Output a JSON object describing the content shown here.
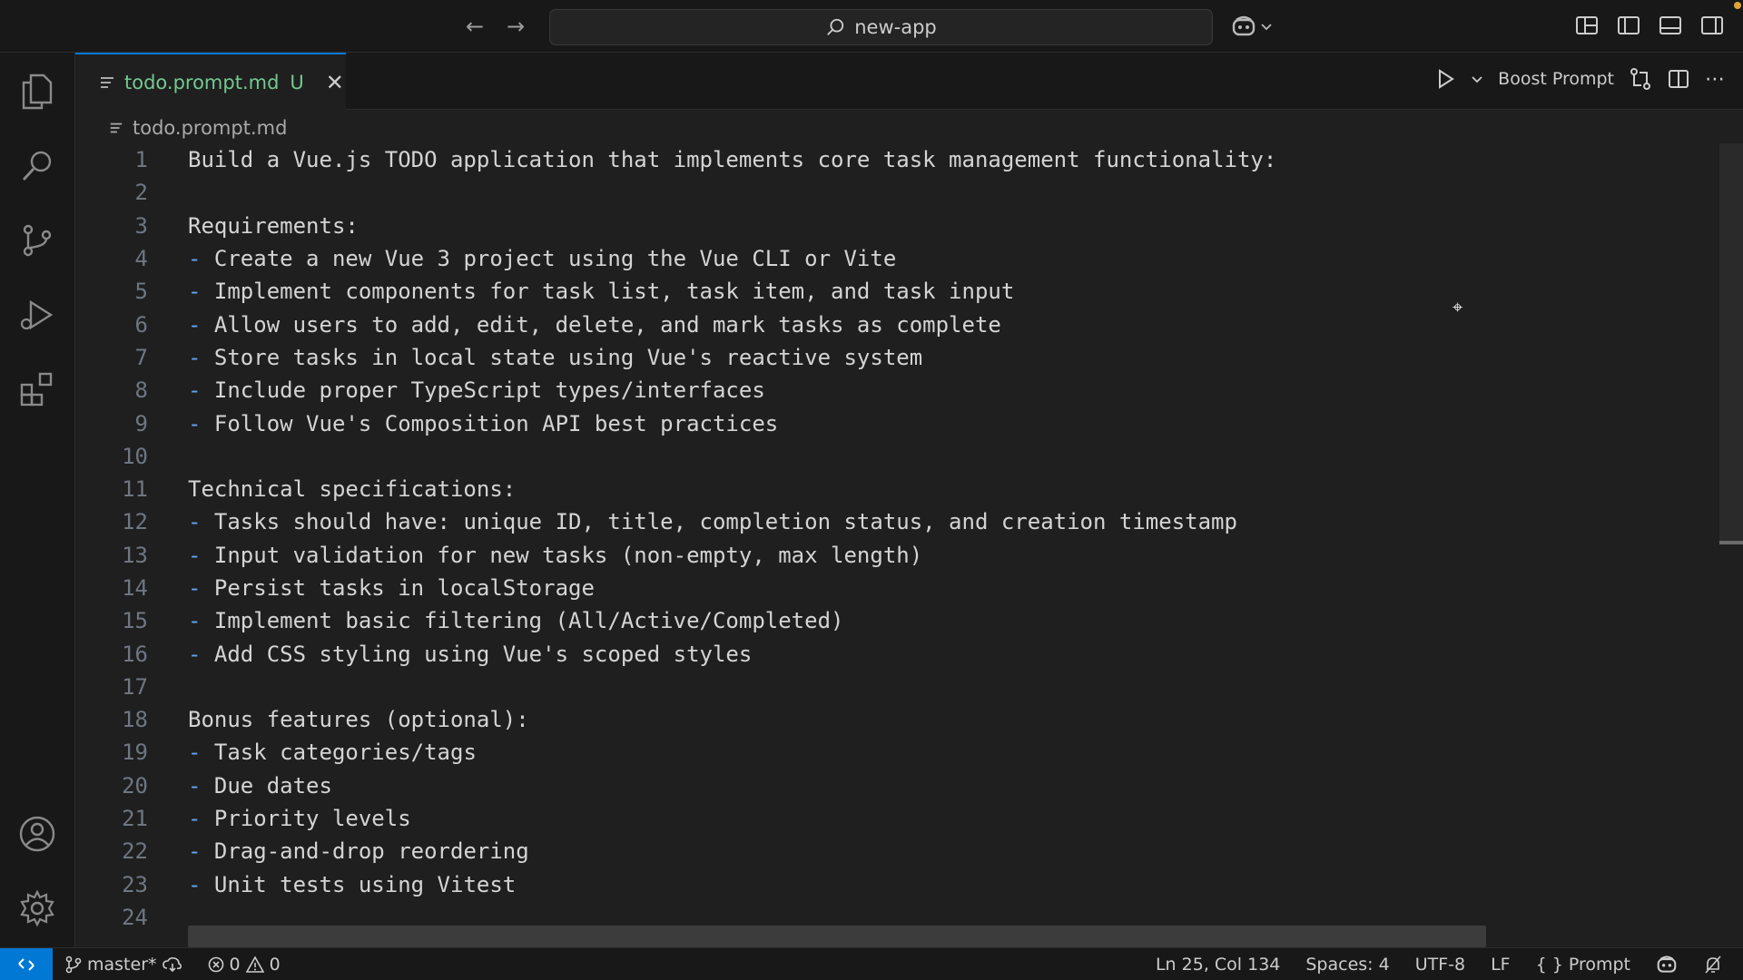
{
  "titlebar": {
    "search_text": "new-app",
    "icons": [
      "arrow-left-icon",
      "arrow-right-icon",
      "search-icon",
      "copilot-icon",
      "chevron-down-icon",
      "customize-layout-icon",
      "toggle-primary-sidebar-icon",
      "toggle-panel-icon",
      "toggle-secondary-sidebar-icon"
    ]
  },
  "activitybar": {
    "items": [
      "explorer",
      "search",
      "source-control",
      "run-and-debug",
      "extensions",
      "accounts",
      "manage"
    ]
  },
  "tab": {
    "label": "todo.prompt.md",
    "status": "U"
  },
  "editor_actions": {
    "boost_label": "Boost Prompt"
  },
  "breadcrumb": {
    "file": "todo.prompt.md"
  },
  "editor": {
    "lines": [
      {
        "n": "1",
        "text": "Build a Vue.js TODO application that implements core task management functionality:"
      },
      {
        "n": "2",
        "text": ""
      },
      {
        "n": "3",
        "text": "Requirements:"
      },
      {
        "n": "4",
        "text": "- Create a new Vue 3 project using the Vue CLI or Vite"
      },
      {
        "n": "5",
        "text": "- Implement components for task list, task item, and task input"
      },
      {
        "n": "6",
        "text": "- Allow users to add, edit, delete, and mark tasks as complete"
      },
      {
        "n": "7",
        "text": "- Store tasks in local state using Vue's reactive system"
      },
      {
        "n": "8",
        "text": "- Include proper TypeScript types/interfaces"
      },
      {
        "n": "9",
        "text": "- Follow Vue's Composition API best practices"
      },
      {
        "n": "10",
        "text": ""
      },
      {
        "n": "11",
        "text": "Technical specifications:"
      },
      {
        "n": "12",
        "text": "- Tasks should have: unique ID, title, completion status, and creation timestamp"
      },
      {
        "n": "13",
        "text": "- Input validation for new tasks (non-empty, max length)"
      },
      {
        "n": "14",
        "text": "- Persist tasks in localStorage"
      },
      {
        "n": "15",
        "text": "- Implement basic filtering (All/Active/Completed)"
      },
      {
        "n": "16",
        "text": "- Add CSS styling using Vue's scoped styles"
      },
      {
        "n": "17",
        "text": ""
      },
      {
        "n": "18",
        "text": "Bonus features (optional):"
      },
      {
        "n": "19",
        "text": "- Task categories/tags"
      },
      {
        "n": "20",
        "text": "- Due dates"
      },
      {
        "n": "21",
        "text": "- Priority levels"
      },
      {
        "n": "22",
        "text": "- Drag-and-drop reordering"
      },
      {
        "n": "23",
        "text": "- Unit tests using Vitest"
      },
      {
        "n": "24",
        "text": ""
      }
    ]
  },
  "statusbar": {
    "branch": "master*",
    "errors": "0",
    "warnings": "0",
    "position": "Ln 25, Col 134",
    "spaces": "Spaces: 4",
    "encoding": "UTF-8",
    "eol": "LF",
    "language": "Prompt"
  },
  "colors": {
    "accent": "#0078d4",
    "untracked": "#73c991",
    "dash": "#5ea2f8"
  }
}
